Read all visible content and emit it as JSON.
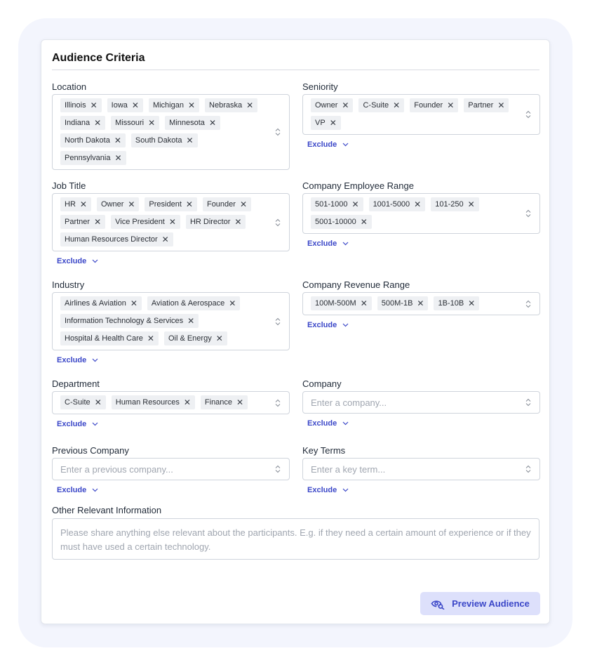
{
  "card": {
    "title": "Audience Criteria"
  },
  "exclude_label": "Exclude",
  "location": {
    "label": "Location",
    "chips": [
      "Illinois",
      "Iowa",
      "Michigan",
      "Nebraska",
      "Indiana",
      "Missouri",
      "Minnesota",
      "North Dakota",
      "South Dakota",
      "Pennsylvania"
    ]
  },
  "seniority": {
    "label": "Seniority",
    "chips": [
      "Owner",
      "C-Suite",
      "Founder",
      "Partner",
      "VP"
    ],
    "exclude": "Exclude"
  },
  "job_title": {
    "label": "Job Title",
    "chips": [
      "HR",
      "Owner",
      "President",
      "Founder",
      "Partner",
      "Vice President",
      "HR Director",
      "Human Resources Director"
    ],
    "exclude": "Exclude"
  },
  "employee_range": {
    "label": "Company Employee Range",
    "chips": [
      "501-1000",
      "1001-5000",
      "101-250",
      "5001-10000"
    ],
    "exclude": "Exclude"
  },
  "industry": {
    "label": "Industry",
    "chips": [
      "Airlines & Aviation",
      "Aviation & Aerospace",
      "Information Technology & Services",
      "Hospital & Health Care",
      "Oil & Energy"
    ],
    "exclude": "Exclude"
  },
  "revenue_range": {
    "label": "Company Revenue Range",
    "chips": [
      "100M-500M",
      "500M-1B",
      "1B-10B"
    ],
    "exclude": "Exclude"
  },
  "department": {
    "label": "Department",
    "chips": [
      "C-Suite",
      "Human Resources",
      "Finance"
    ],
    "exclude": "Exclude"
  },
  "company": {
    "label": "Company",
    "placeholder": "Enter a company...",
    "exclude": "Exclude"
  },
  "previous_company": {
    "label": "Previous Company",
    "placeholder": "Enter a previous company...",
    "exclude": "Exclude"
  },
  "key_terms": {
    "label": "Key Terms",
    "placeholder": "Enter a key term...",
    "exclude": "Exclude"
  },
  "other_info": {
    "label": "Other Relevant Information",
    "placeholder": "Please share anything else relevant about the participants. E.g. if they need a certain amount of experience or if they must have used a certain technology."
  },
  "preview_button": {
    "label": "Preview Audience"
  },
  "colors": {
    "accent": "#3b47c8",
    "button_bg": "#dde0fb",
    "chip_bg": "#eef0f3",
    "outer_bg": "#f3f5fd"
  },
  "icons": {
    "chip_remove": "close-icon",
    "select_toggle": "chevron-up-down-icon",
    "exclude_toggle": "chevron-down-icon",
    "preview": "eye-search-icon"
  }
}
